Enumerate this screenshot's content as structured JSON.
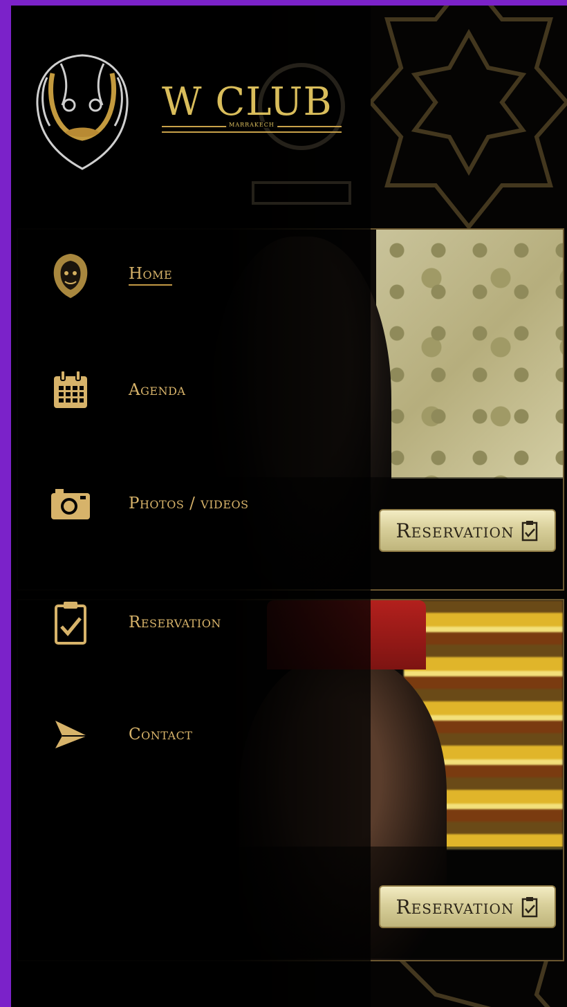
{
  "brand": {
    "name": "W CLUB",
    "sub": "MARRAKECH"
  },
  "menu": [
    {
      "label": "Home",
      "icon": "lion-head-icon"
    },
    {
      "label": "Agenda",
      "icon": "calendar-icon"
    },
    {
      "label": "Photos / videos",
      "icon": "camera-icon"
    },
    {
      "label": "Reservation",
      "icon": "clipboard-check-icon"
    },
    {
      "label": "Contact",
      "icon": "paper-plane-icon"
    }
  ],
  "cards": [
    {
      "reservation_label": "Reservation"
    },
    {
      "reservation_label": "Reservation"
    }
  ],
  "colors": {
    "gold": "#d7b36a",
    "frame": "#7b22c9",
    "background": "#050403"
  }
}
